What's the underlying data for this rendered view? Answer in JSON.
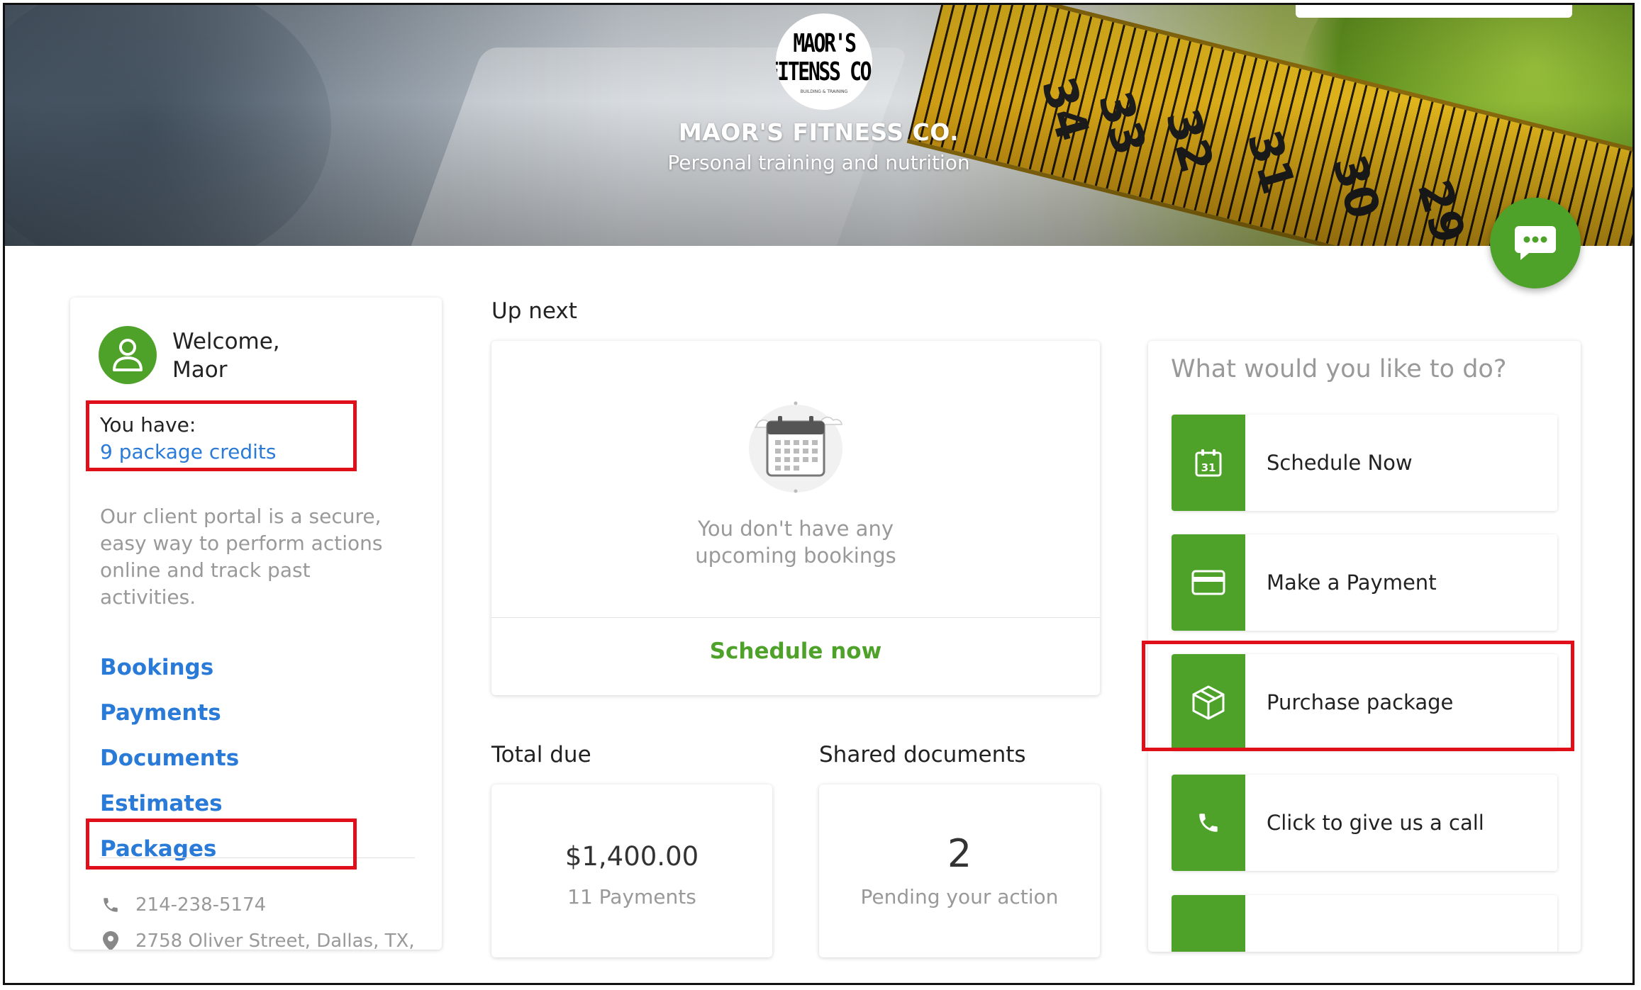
{
  "header": {
    "logo_line1": "MAOR'S",
    "logo_line2": "FITENSS CO.",
    "logo_tagline": "BUILDING & TRAINING",
    "business_name": "MAOR'S FITNESS CO.",
    "tagline": "Personal training and nutrition",
    "tape_numbers": [
      "34",
      "33",
      "32",
      "31",
      "30",
      "29"
    ]
  },
  "profile": {
    "welcome_line1": "Welcome,",
    "welcome_line2": "Maor",
    "you_have_label": "You have:",
    "credits_link": "9 package credits",
    "description": "Our client portal is a secure, easy way to perform actions online and track past activities."
  },
  "nav": {
    "items": [
      {
        "label": "Bookings"
      },
      {
        "label": "Payments"
      },
      {
        "label": "Documents"
      },
      {
        "label": "Estimates"
      },
      {
        "label": "Packages"
      }
    ]
  },
  "contact": {
    "phone": "214-238-5174",
    "address": "2758 Oliver Street, Dallas, TX,"
  },
  "up_next": {
    "title": "Up next",
    "empty_line1": "You don't have any",
    "empty_line2": "upcoming bookings",
    "schedule_link": "Schedule now"
  },
  "total_due": {
    "title": "Total due",
    "amount": "$1,400.00",
    "payments": "11 Payments"
  },
  "shared_documents": {
    "title": "Shared documents",
    "count": "2",
    "status": "Pending your action"
  },
  "actions": {
    "title": "What would you like to do?",
    "items": [
      {
        "label": "Schedule Now",
        "icon": "calendar-icon"
      },
      {
        "label": "Make a Payment",
        "icon": "credit-card-icon"
      },
      {
        "label": "Purchase package",
        "icon": "package-icon"
      },
      {
        "label": "Click to give us a call",
        "icon": "phone-icon"
      }
    ]
  },
  "colors": {
    "accent_green": "#4ea22a",
    "link_blue": "#2a7ad8",
    "highlight_red": "#e0101a"
  }
}
